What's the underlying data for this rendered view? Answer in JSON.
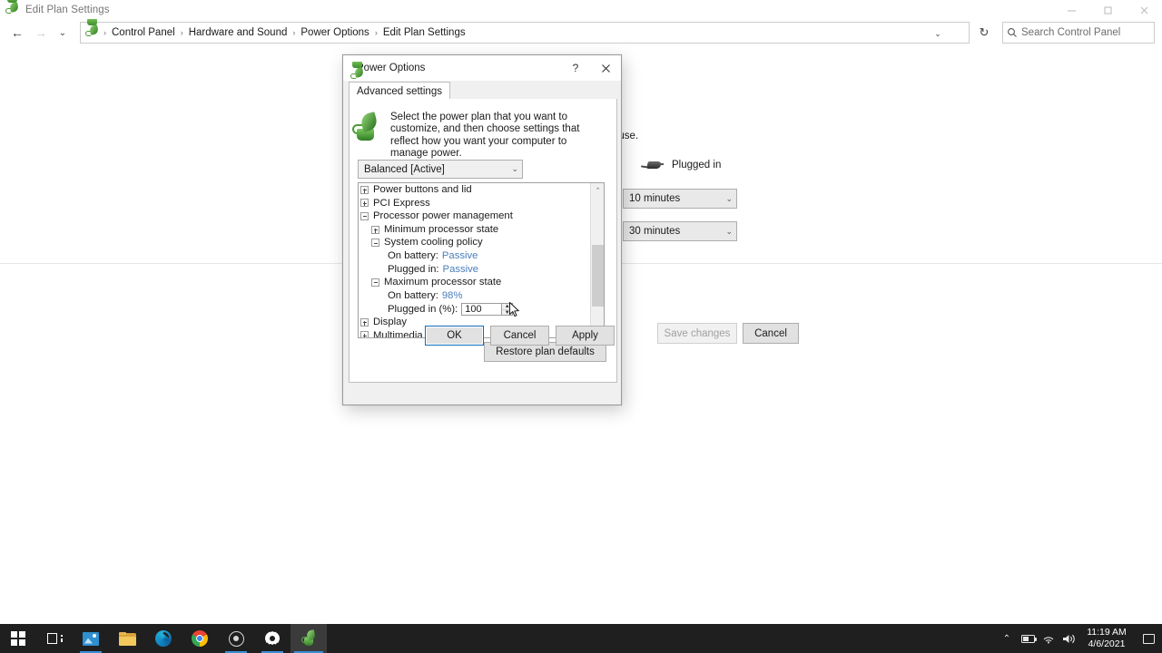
{
  "window": {
    "title": "Edit Plan Settings",
    "icon": "power-plan-icon",
    "minimize_label": "─",
    "maximize_label": "☐",
    "close_label": "✕"
  },
  "addressbar": {
    "back_label": "←",
    "forward_label": "→",
    "history_label": "⌄",
    "up_label": "↑",
    "breadcrumbs": [
      "Control Panel",
      "Hardware and Sound",
      "Power Options",
      "Edit Plan Settings"
    ],
    "separator": "›",
    "dropdown_label": "⌄",
    "refresh_label": "↻",
    "search": {
      "placeholder": "Search Control Panel",
      "icon": "search-icon"
    }
  },
  "content": {
    "hint_text": "ter to use.",
    "plugged_in_label": "Plugged in",
    "combo_display_sleep": "10 minutes",
    "combo_sleep": "30 minutes",
    "save_changes_label": "Save changes",
    "cancel_label": "Cancel"
  },
  "dialog": {
    "title": "Power Options",
    "help_label": "?",
    "close_label": "✕",
    "tab_label": "Advanced settings",
    "description": "Select the power plan that you want to customize, and then choose settings that reflect how you want your computer to manage power.",
    "plan_combo": "Balanced [Active]",
    "plan_combo_chevron": "⌄",
    "restore_label": "Restore plan defaults",
    "ok_label": "OK",
    "cancel_label": "Cancel",
    "apply_label": "Apply",
    "scroll_up": "⌃",
    "scroll_down": "⌄",
    "spinner": {
      "value": "100",
      "up_label": "▲",
      "down_label": "▼"
    },
    "tree": [
      {
        "indent": 1,
        "toggle": "plus",
        "label": "Power buttons and lid"
      },
      {
        "indent": 1,
        "toggle": "plus",
        "label": "PCI Express"
      },
      {
        "indent": 1,
        "toggle": "minus",
        "label": "Processor power management"
      },
      {
        "indent": 2,
        "toggle": "plus",
        "label": "Minimum processor state"
      },
      {
        "indent": 2,
        "toggle": "minus",
        "label": "System cooling policy"
      },
      {
        "indent": 3,
        "toggle": "none",
        "label": "On battery:",
        "value": "Passive"
      },
      {
        "indent": 3,
        "toggle": "none",
        "label": "Plugged in:",
        "value": "Passive"
      },
      {
        "indent": 2,
        "toggle": "minus",
        "label": "Maximum processor state"
      },
      {
        "indent": 3,
        "toggle": "none",
        "label": "On battery:",
        "value": "98%"
      },
      {
        "indent": 3,
        "toggle": "none",
        "label": "Plugged in (%):",
        "selected": true,
        "spinner": true
      },
      {
        "indent": 1,
        "toggle": "plus",
        "label": "Display"
      },
      {
        "indent": 1,
        "toggle": "plus",
        "label": "Multimedia settings"
      }
    ]
  },
  "taskbar": {
    "items": [
      {
        "name": "start-button",
        "icon": "windows-logo-icon",
        "active": false,
        "indicator": false
      },
      {
        "name": "task-view-button",
        "icon": "task-view-icon",
        "active": false,
        "indicator": false
      },
      {
        "name": "photos-app",
        "icon": "photos-icon",
        "active": false,
        "indicator": true
      },
      {
        "name": "file-explorer-app",
        "icon": "folder-icon",
        "active": false,
        "indicator": false
      },
      {
        "name": "edge-browser-app",
        "icon": "edge-icon",
        "active": false,
        "indicator": false
      },
      {
        "name": "chrome-browser-app",
        "icon": "chrome-icon",
        "active": false,
        "indicator": false
      },
      {
        "name": "obs-studio-app",
        "icon": "obs-icon",
        "active": false,
        "indicator": true
      },
      {
        "name": "settings-app",
        "icon": "gear-icon",
        "active": false,
        "indicator": true
      },
      {
        "name": "power-options-app",
        "icon": "power-plan-icon",
        "active": true,
        "indicator": true
      }
    ],
    "tray": {
      "chevron": "⌃",
      "battery_icon": "battery-icon",
      "network_icon": "wifi-icon",
      "network_glyph": "◠",
      "volume_icon": "volume-icon",
      "volume_glyph": "🔊",
      "time": "11:19 AM",
      "date": "4/6/2021",
      "notifications_icon": "notification-center-icon"
    }
  }
}
